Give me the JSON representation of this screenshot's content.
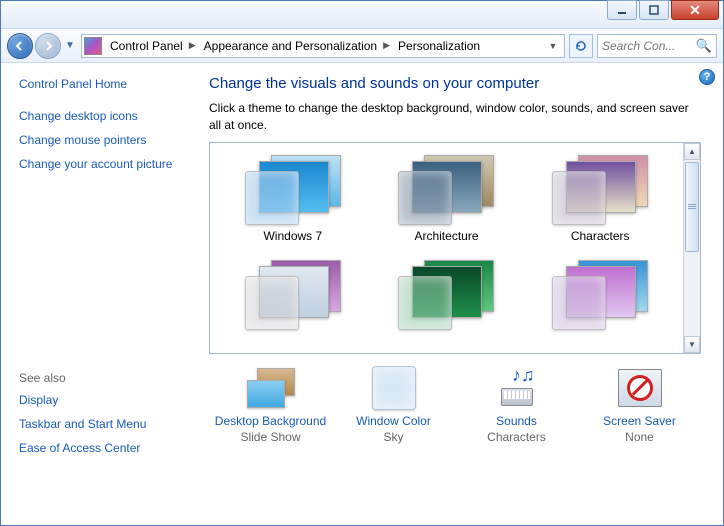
{
  "window": {
    "title": ""
  },
  "breadcrumb": {
    "root": "Control Panel",
    "mid": "Appearance and Personalization",
    "leaf": "Personalization"
  },
  "search": {
    "placeholder": "Search Con..."
  },
  "sidebar": {
    "home": "Control Panel Home",
    "links": [
      "Change desktop icons",
      "Change mouse pointers",
      "Change your account picture"
    ],
    "seealso_label": "See also",
    "seealso": [
      "Display",
      "Taskbar and Start Menu",
      "Ease of Access Center"
    ]
  },
  "main": {
    "heading": "Change the visuals and sounds on your computer",
    "subtext": "Click a theme to change the desktop background, window color, sounds, and screen saver all at once.",
    "themes": [
      "Windows 7",
      "Architecture",
      "Characters",
      "",
      "",
      ""
    ]
  },
  "options": {
    "bg": {
      "label": "Desktop Background",
      "value": "Slide Show"
    },
    "wc": {
      "label": "Window Color",
      "value": "Sky"
    },
    "snd": {
      "label": "Sounds",
      "value": "Characters"
    },
    "ss": {
      "label": "Screen Saver",
      "value": "None"
    }
  }
}
